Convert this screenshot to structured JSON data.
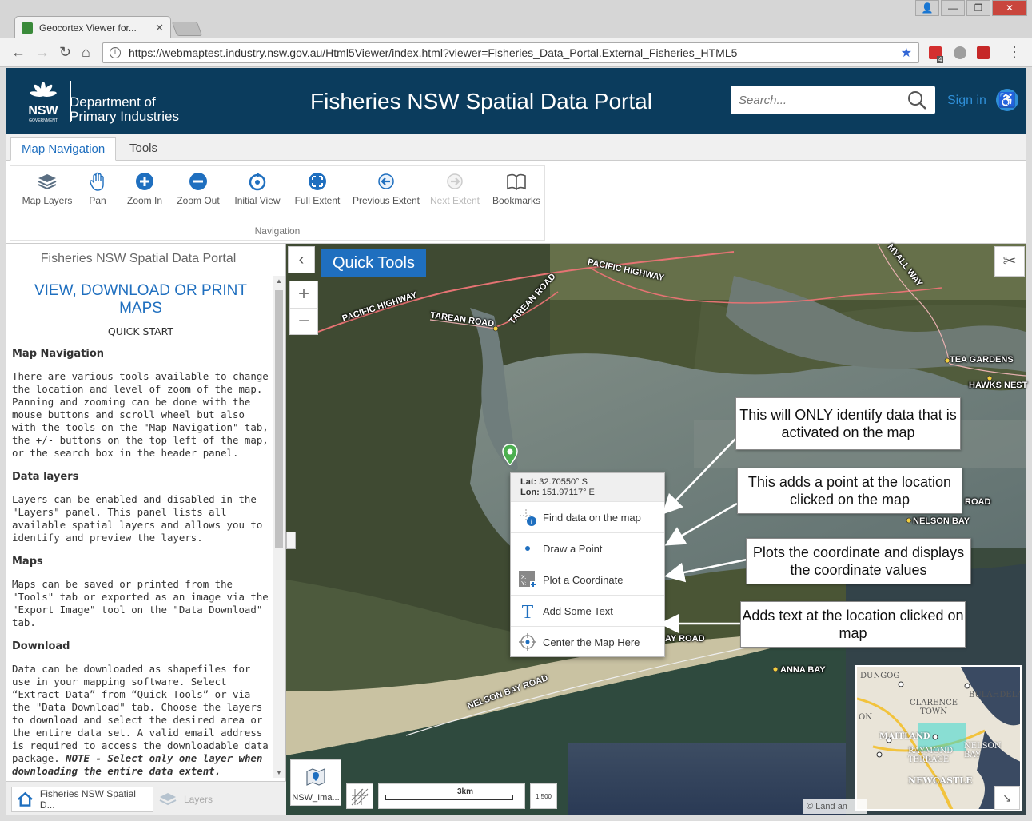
{
  "browser": {
    "tab_title": "Geocortex Viewer for...",
    "url": "https://webmaptest.industry.nsw.gov.au/Html5Viewer/index.html?viewer=Fisheries_Data_Portal.External_Fisheries_HTML5",
    "extension_badge": "4"
  },
  "header": {
    "logo_text": "NSW",
    "logo_sub": "GOVERNMENT",
    "dept_line1": "Department of",
    "dept_line2": "Primary Industries",
    "title": "Fisheries NSW Spatial Data Portal",
    "search_placeholder": "Search...",
    "sign_in": "Sign in"
  },
  "ribbon": {
    "tabs": [
      "Map Navigation",
      "Tools"
    ],
    "group_label": "Navigation",
    "tools": [
      "Map Layers",
      "Pan",
      "Zoom In",
      "Zoom Out",
      "Initial View",
      "Full Extent",
      "Previous Extent",
      "Next Extent",
      "Bookmarks"
    ]
  },
  "left_panel": {
    "title": "Fisheries NSW Spatial Data Portal",
    "heading": "VIEW, DOWNLOAD OR PRINT MAPS",
    "subheading": "QUICK START",
    "sections": [
      {
        "title": "Map Navigation",
        "text": "There are various tools available to change the location and level of zoom of the map. Panning and zooming can be done with the mouse buttons and scroll wheel but also with the tools on the \"Map Navigation\" tab, the +/- buttons on the top left of the map, or the search box in the header panel."
      },
      {
        "title": "Data layers",
        "text": "Layers can be enabled and disabled in the \"Layers\" panel. This panel lists all available spatial layers and allows you to identify and preview the layers."
      },
      {
        "title": "Maps",
        "text": "Maps can be saved or printed from the \"Tools\" tab or exported as an image via the \"Export Image\" tool on the \"Data Download\" tab."
      },
      {
        "title": "Download",
        "text": "Data can be downloaded as shapefiles for use in your mapping software. Select “Extract Data” from “Quick Tools” or via the \"Data Download\" tab. Choose the layers to download and select the desired area or the entire data set. A valid email address is required to access the downloadable data package."
      },
      {
        "title": "",
        "text": "NOTE - Select only one layer when downloading the entire data extent."
      }
    ],
    "bottom_tabs": [
      "Fisheries NSW Spatial D...",
      "Layers"
    ]
  },
  "map": {
    "quick_tools": "Quick Tools",
    "zoom_in": "+",
    "zoom_out": "−",
    "coords": {
      "lat_label": "Lat:",
      "lat": "32.70550° S",
      "lon_label": "Lon:",
      "lon": "151.97117° E"
    },
    "menu": [
      "Find data on the map",
      "Draw a Point",
      "Plot a Coordinate",
      "Add Some Text",
      "Center the Map Here"
    ],
    "callouts": [
      "This will ONLY identify data that is activated on the map",
      "This adds a point at the location clicked on the map",
      "Plots the coordinate and displays the coordinate values",
      "Adds text at the location clicked on map"
    ],
    "labels": {
      "pacific_hwy_1": "PACIFIC HIGHWAY",
      "pacific_hwy_2": "PACIFIC HIGHWAY",
      "tarean_1": "TAREAN ROAD",
      "tarean_2": "TAREAN ROAD",
      "myall_way": "MYALL WAY",
      "tea_gardens": "TEA GARDENS",
      "hawks_nest": "HAWKS NEST",
      "road": "ROAD",
      "nelson_bay": "NELSON BAY",
      "bay_road": "AY ROAD",
      "anna_bay": "ANNA BAY",
      "nelson_bay_road": "NELSON BAY ROAD"
    },
    "basemap_label": "NSW_Ima...",
    "scale_label": "3km",
    "scale_btn": "1:500",
    "attribution": "© Land an",
    "overview_labels": [
      "DUNGOG",
      "CLARENCE TOWN",
      "BULAHDELAH",
      "MAITLAND",
      "RAYMOND TERRACE",
      "NELSON BAY",
      "NEWCASTLE",
      "ON"
    ]
  },
  "colors": {
    "header_bg": "#0b3c5d",
    "accent": "#1f6fbf",
    "pin": "#4caf50"
  }
}
